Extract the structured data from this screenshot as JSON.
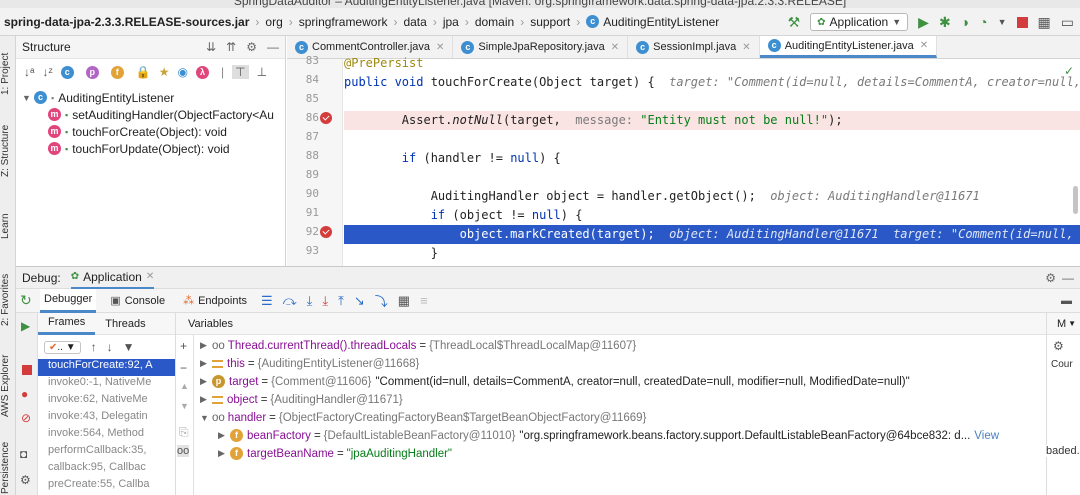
{
  "window": {
    "title": "SpringDataAuditor – AuditingEntityListener.java [Maven: org.springframework.data:spring-data-jpa:2.3.3.RELEASE]"
  },
  "breadcrumbs": [
    "spring-data-jpa-2.3.3.RELEASE-sources.jar",
    "org",
    "springframework",
    "data",
    "jpa",
    "domain",
    "support",
    "AuditingEntityListener"
  ],
  "run_config": {
    "label": "Application"
  },
  "left_tool_windows": [
    "1: Project",
    "Z: Structure",
    "Learn",
    "2: Favorites",
    "AWS Explorer",
    "Persistence"
  ],
  "structure": {
    "title": "Structure",
    "root": "AuditingEntityListener",
    "members": [
      {
        "name": "setAuditingHandler(ObjectFactory<Au",
        "icon": "method-icon"
      },
      {
        "name": "touchForCreate(Object): void",
        "icon": "method-icon"
      },
      {
        "name": "touchForUpdate(Object): void",
        "icon": "method-icon"
      }
    ]
  },
  "editor": {
    "tabs": [
      {
        "label": "CommentController.java",
        "active": false
      },
      {
        "label": "SimpleJpaRepository.java",
        "active": false
      },
      {
        "label": "SessionImpl.java",
        "active": false
      },
      {
        "label": "AuditingEntityListener.java",
        "active": true
      }
    ],
    "line_numbers": [
      "83",
      "84",
      "85",
      "86",
      "87",
      "88",
      "89",
      "90",
      "91",
      "92",
      "93"
    ],
    "lines": {
      "l83": "@PrePersist",
      "l84_kw": "public void ",
      "l84_code": "touchForCreate(Object target) {",
      "l84_hint": "  target: \"Comment(id=null, details=CommentA, creator=null,",
      "l86_code": "    Assert.",
      "l86_method": "notNull",
      "l86_rest": "(target, ",
      "l86_hint": " message: ",
      "l86_str": "\"Entity must not be null!\"",
      "l86_end": ");",
      "l88_kw": "    if ",
      "l88_code": "(handler != ",
      "l88_null": "null",
      "l88_end": ") {",
      "l90_code": "        AuditingHandler object = handler.getObject();",
      "l90_hint": "  object: AuditingHandler@11671",
      "l91_kw": "        if ",
      "l91_code": "(object != ",
      "l91_null": "null",
      "l91_end": ") {",
      "l92_code": "            object.markCreated(target);",
      "l92_hint": "  object: AuditingHandler@11671  target: \"Comment(id=null, deta",
      "l93_code": "        }"
    }
  },
  "debug": {
    "label": "Debug:",
    "session": "Application",
    "tabs": [
      "Debugger",
      "Console",
      "Endpoints"
    ],
    "frames_tab": "Frames",
    "threads_tab": "Threads",
    "variables_tab": "Variables",
    "right_tab": "M",
    "right_label": "Cour",
    "right_status": "baded. L",
    "frames": [
      {
        "label": "touchForCreate:92, A",
        "selected": true
      },
      {
        "label": "invoke0:-1, NativeMe",
        "selected": false
      },
      {
        "label": "invoke:62, NativeMe",
        "selected": false
      },
      {
        "label": "invoke:43, Delegatin",
        "selected": false
      },
      {
        "label": "invoke:564, Method",
        "selected": false
      },
      {
        "label": "performCallback:35,",
        "selected": false
      },
      {
        "label": "callback:95, Callbac",
        "selected": false
      },
      {
        "label": "preCreate:55, Callba",
        "selected": false
      }
    ],
    "variables": [
      {
        "name": "Thread.currentThread().threadLocals",
        "value": "{ThreadLocal$ThreadLocalMap@11607}",
        "str": ""
      },
      {
        "name": "this",
        "value": "{AuditingEntityListener@11668}",
        "str": ""
      },
      {
        "name": "target",
        "value": "{Comment@11606}",
        "str": "\"Comment(id=null, details=CommentA, creator=null, createdDate=null, modifier=null, ModifiedDate=null)\""
      },
      {
        "name": "object",
        "value": "{AuditingHandler@11671}",
        "str": ""
      },
      {
        "name": "handler",
        "value": "{ObjectFactoryCreatingFactoryBean$TargetBeanObjectFactory@11669}",
        "str": ""
      },
      {
        "name": "beanFactory",
        "value": "{DefaultListableBeanFactory@11010}",
        "str": "\"org.springframework.beans.factory.support.DefaultListableBeanFactory@64bce832: d...",
        "link": "View"
      },
      {
        "name": "targetBeanName",
        "value": "",
        "str": "\"jpaAuditingHandler\""
      }
    ]
  }
}
